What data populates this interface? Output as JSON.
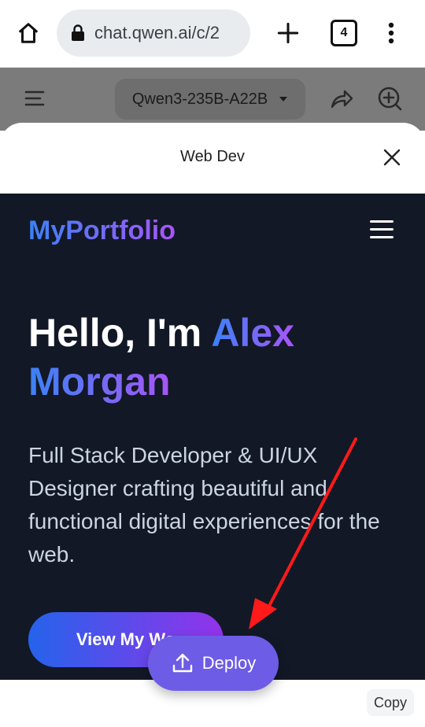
{
  "browser": {
    "url": "chat.qwen.ai/c/2",
    "tab_count": "4",
    "icons": [
      "home-icon",
      "lock-icon",
      "plus-icon",
      "tabs-icon",
      "more-vertical-icon"
    ]
  },
  "chat_header": {
    "model_name": "Qwen3-235B-A22B",
    "icons": [
      "sidebar-icon",
      "chevron-down-icon",
      "share-icon",
      "new-chat-icon"
    ]
  },
  "sheet": {
    "title": "Web Dev",
    "close_icon": "close-icon"
  },
  "preview": {
    "logo": "MyPortfolio",
    "hero_title_prefix": "Hello, I'm",
    "hero_title_name_1": "Alex",
    "hero_title_name_2": "Morgan",
    "description": "Full Stack Developer & UI/UX Designer crafting beautiful and functional digital experiences for the web.",
    "cta_label": "View My Wo",
    "colors": {
      "background": "#121826",
      "gradient_start": "#3b82f6",
      "gradient_end": "#a855f7"
    }
  },
  "actions": {
    "deploy_label": "Deploy",
    "copy_label": "Copy",
    "deploy_color": "#6d5ce6"
  },
  "annotation": {
    "arrow_color": "#ff1a1a"
  }
}
